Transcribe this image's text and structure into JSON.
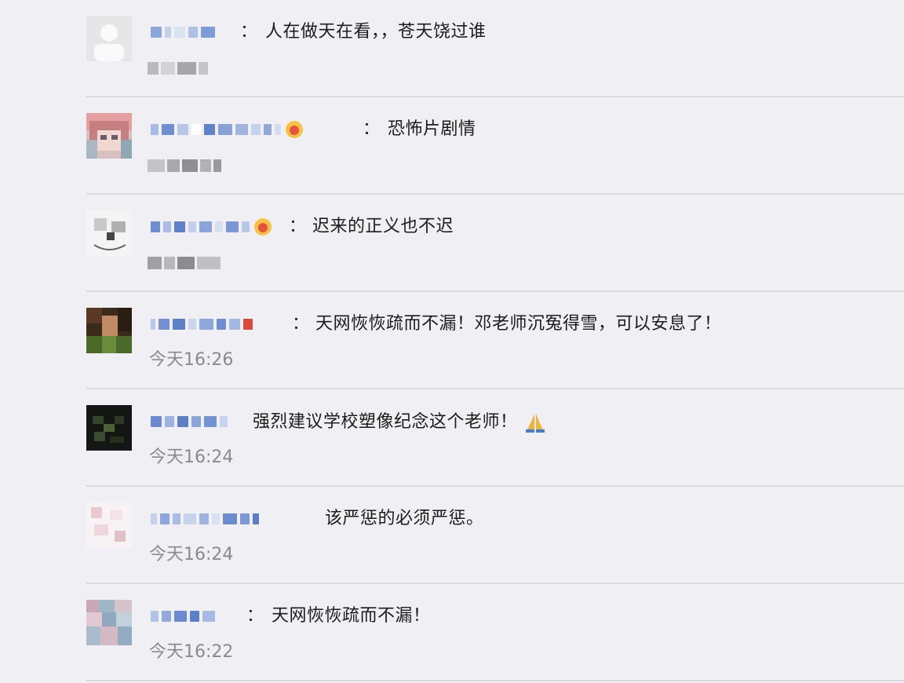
{
  "comments": [
    {
      "separator": "：",
      "text": "人在做天在看，，苍天饶过谁",
      "time": ""
    },
    {
      "separator": "：",
      "text": "恐怖片剧情",
      "time": ""
    },
    {
      "separator": "：",
      "text": "迟来的正义也不迟",
      "time": ""
    },
    {
      "separator": "：",
      "text": "天网恢恢疏而不漏！邓老师沉冤得雪，可以安息了！",
      "time": "今天16:26"
    },
    {
      "separator": "",
      "text": "强烈建议学校塑像纪念这个老师！",
      "emoji": "folded-hands-icon",
      "time": "今天16:24"
    },
    {
      "separator": "",
      "text": "该严惩的必须严惩。",
      "time": "今天16:24"
    },
    {
      "separator": "：",
      "text": "天网恢恢疏而不漏！",
      "time": "今天16:22"
    }
  ],
  "colors": {
    "background": "#efeff4",
    "text": "#1c1c1c",
    "timestamp": "#8a8a8e",
    "nickname_blur": "#7f9fd6"
  }
}
